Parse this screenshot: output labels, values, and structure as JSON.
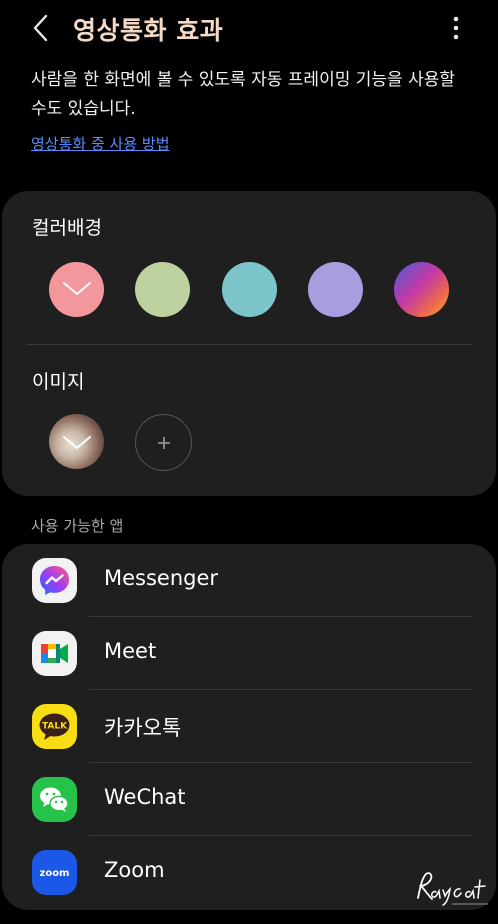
{
  "header": {
    "title": "영상통화 효과",
    "back_icon": "chevron-left-icon",
    "more_icon": "more-vertical-icon"
  },
  "description": {
    "line1": "사람을 한 화면에 볼 수 있도록 자동 프레이밍 기능을 사용할",
    "line2": "수도 있습니다.",
    "link": "영상통화 중 사용 방법"
  },
  "background": {
    "color_label": "컬러배경",
    "colors": [
      "#f3979c",
      "#bdd29f",
      "#7cc6cb",
      "#a79ee0",
      "gradient"
    ],
    "selected_color_index": 0,
    "image_label": "이미지",
    "add_icon": "plus-icon"
  },
  "apps": {
    "label": "사용 가능한 앱",
    "items": [
      {
        "name": "Messenger",
        "icon": "messenger-icon"
      },
      {
        "name": "Meet",
        "icon": "google-meet-icon"
      },
      {
        "name": "카카오톡",
        "icon": "kakaotalk-icon",
        "icon_text": "TALK"
      },
      {
        "name": "WeChat",
        "icon": "wechat-icon"
      },
      {
        "name": "Zoom",
        "icon": "zoom-icon",
        "icon_text": "zoom"
      }
    ]
  },
  "watermark": {
    "text": "Raycat"
  }
}
